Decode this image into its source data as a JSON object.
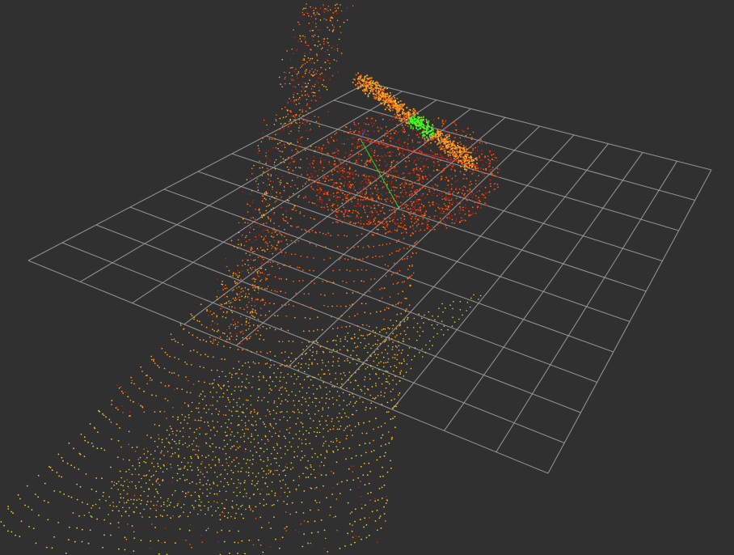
{
  "viewer": {
    "background_color": "#303030",
    "grid": {
      "visible": true,
      "color": "#a0a0a0",
      "cell_count": 10
    },
    "point_cloud": {
      "color_map": [
        "#c81e0a",
        "#ff5a10",
        "#ff9a1e",
        "#f5c82a",
        "#c8e632",
        "#3cff1e"
      ],
      "color_map_description": "intensity"
    },
    "axes": {
      "visible": true,
      "x_color": "#ff2020",
      "y_color": "#20ff20",
      "z_color": "#3060ff"
    }
  }
}
